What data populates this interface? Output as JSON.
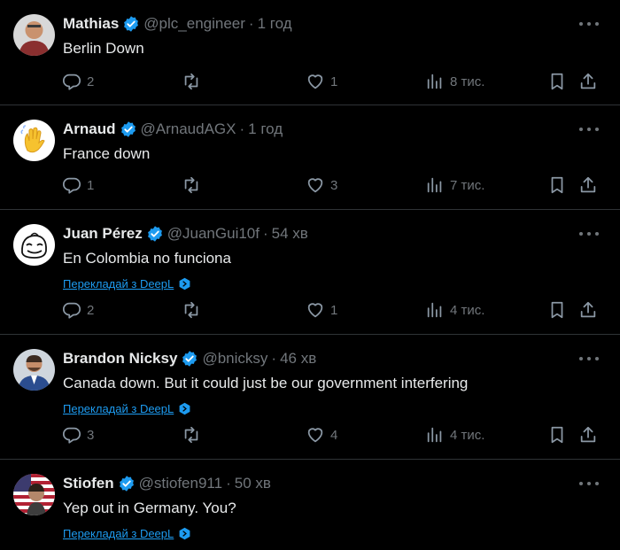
{
  "posts": [
    {
      "name": "Mathias",
      "handle": "@plc_engineer",
      "sep": "·",
      "time": "1 год",
      "text": "Berlin Down",
      "translate": "",
      "replies": "2",
      "retweets": "",
      "likes": "1",
      "views": "8 тис."
    },
    {
      "name": "Arnaud",
      "handle": "@ArnaudAGX",
      "sep": "·",
      "time": "1 год",
      "text": "France down",
      "translate": "",
      "replies": "1",
      "retweets": "",
      "likes": "3",
      "views": "7 тис."
    },
    {
      "name": "Juan Pérez",
      "handle": "@JuanGui10f",
      "sep": "·",
      "time": "54 хв",
      "text": "En Colombia no funciona",
      "translate": "Перекладай з DeepL",
      "replies": "2",
      "retweets": "",
      "likes": "1",
      "views": "4 тис."
    },
    {
      "name": "Brandon Nicksy",
      "handle": "@bnicksy",
      "sep": "·",
      "time": "46 хв",
      "text": "Canada down. But it could just be our government interfering",
      "translate": "Перекладай з DeepL",
      "replies": "3",
      "retweets": "",
      "likes": "4",
      "views": "4 тис."
    },
    {
      "name": "Stiofen",
      "handle": "@stiofen911",
      "sep": "·",
      "time": "50 хв",
      "text": "Yep out in Germany. You?",
      "translate": "Перекладай з DeepL",
      "replies": "",
      "retweets": "",
      "likes": "",
      "views": ""
    }
  ],
  "colors": {
    "background": "#000000",
    "text": "#e7e9ea",
    "muted": "#71767b",
    "link": "#1d9bf0",
    "verified": "#1d9bf0",
    "divider": "#2f3336"
  }
}
